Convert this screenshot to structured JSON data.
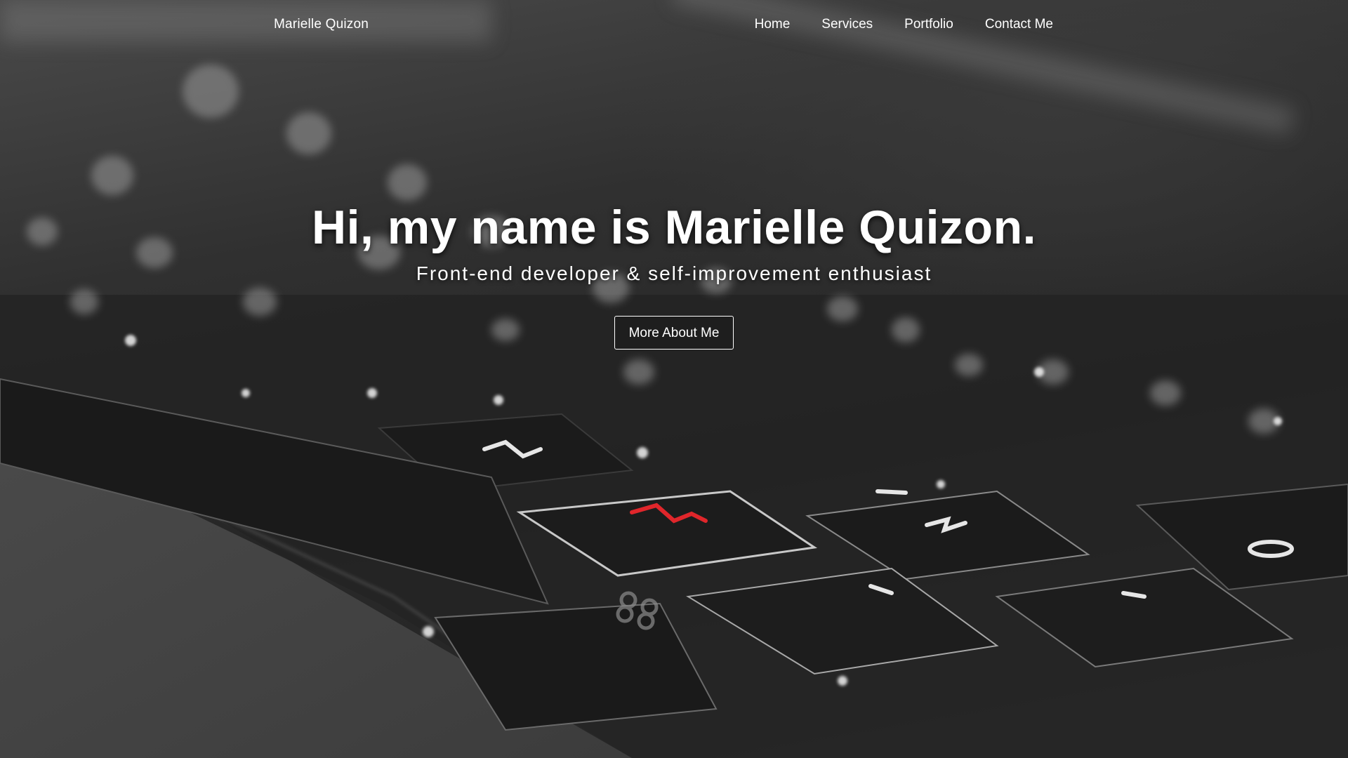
{
  "navbar": {
    "brand": "Marielle Quizon",
    "links": [
      {
        "label": "Home"
      },
      {
        "label": "Services"
      },
      {
        "label": "Portfolio"
      },
      {
        "label": "Contact Me"
      }
    ]
  },
  "hero": {
    "title": "Hi, my name is Marielle Quizon.",
    "subtitle": "Front-end developer & self-improvement enthusiast",
    "cta_label": "More About Me",
    "background_image": "keyboard-photo",
    "background_tone": "grayscale"
  },
  "colors": {
    "text": "#ffffff",
    "background": "#2a2a2a",
    "key_accent": "#e0262b"
  }
}
